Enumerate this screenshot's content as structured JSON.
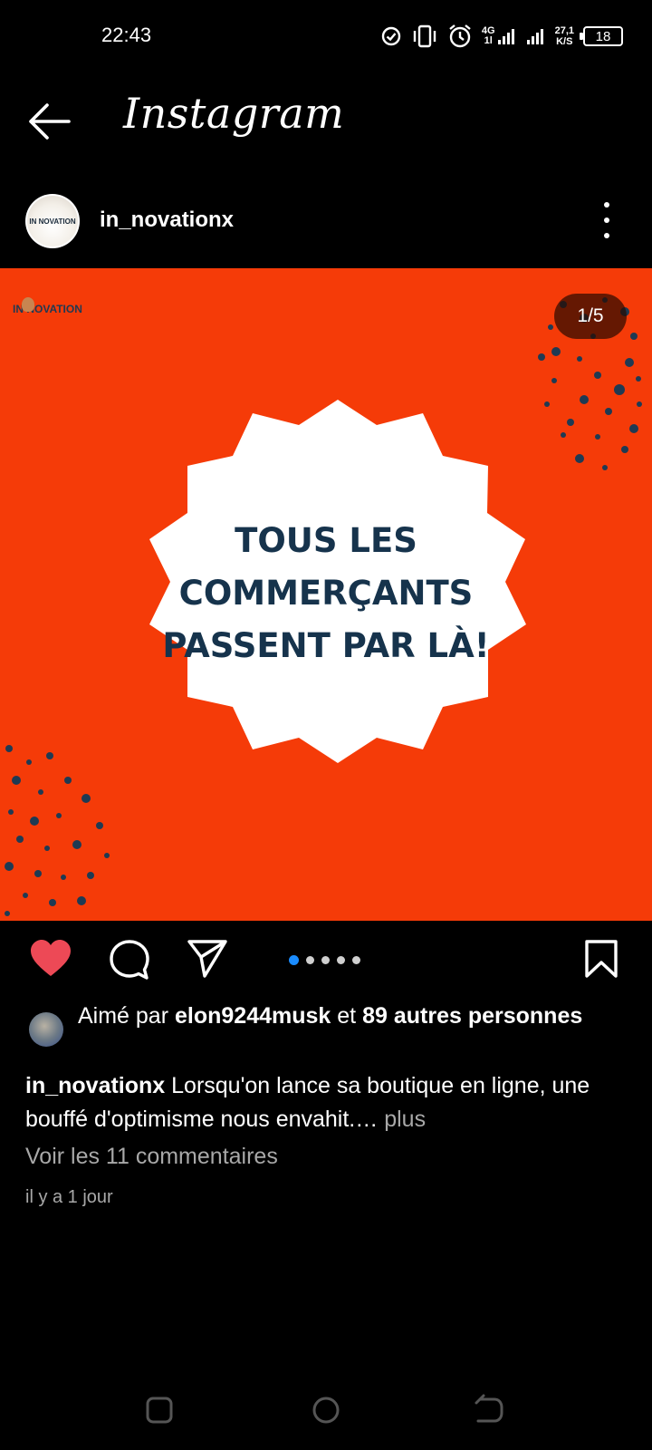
{
  "status_bar": {
    "time": "22:43",
    "network_type_top": "4G",
    "network_type_bottom": "1l",
    "speed_value": "27,1",
    "speed_unit": "K/S",
    "battery_level": "18"
  },
  "header": {
    "app_title": "Instagram"
  },
  "post": {
    "username": "in_novationx",
    "avatar_text": "IN NOVATION",
    "image": {
      "brand_logo": "IN NOVATION",
      "counter": "1/5",
      "headline_line1": "TOUS LES",
      "headline_line2": "COMMERÇANTS",
      "headline_line3": "PASSENT PAR LÀ!",
      "background_color": "#f53b08",
      "text_color": "#16334c"
    },
    "carousel": {
      "total": 5,
      "active_index": 0
    },
    "likes": {
      "prefix": "Aimé par",
      "user": "elon9244musk",
      "connector": "et",
      "others": "89 autres personnes"
    },
    "caption": {
      "username": "in_novationx",
      "text": "Lorsqu'on lance sa boutique en ligne, une bouffé d'optimisme nous envahit.…",
      "more_label": "plus"
    },
    "comments_link": "Voir les 11 commentaires",
    "timestamp": "il y a 1 jour"
  },
  "icons": {
    "back": "back-arrow-icon",
    "more": "more-vertical-icon",
    "like": "heart-filled-icon",
    "comment": "comment-icon",
    "share": "send-icon",
    "save": "bookmark-icon"
  },
  "colors": {
    "like_red": "#ed4956",
    "carousel_active": "#1a8cff"
  }
}
